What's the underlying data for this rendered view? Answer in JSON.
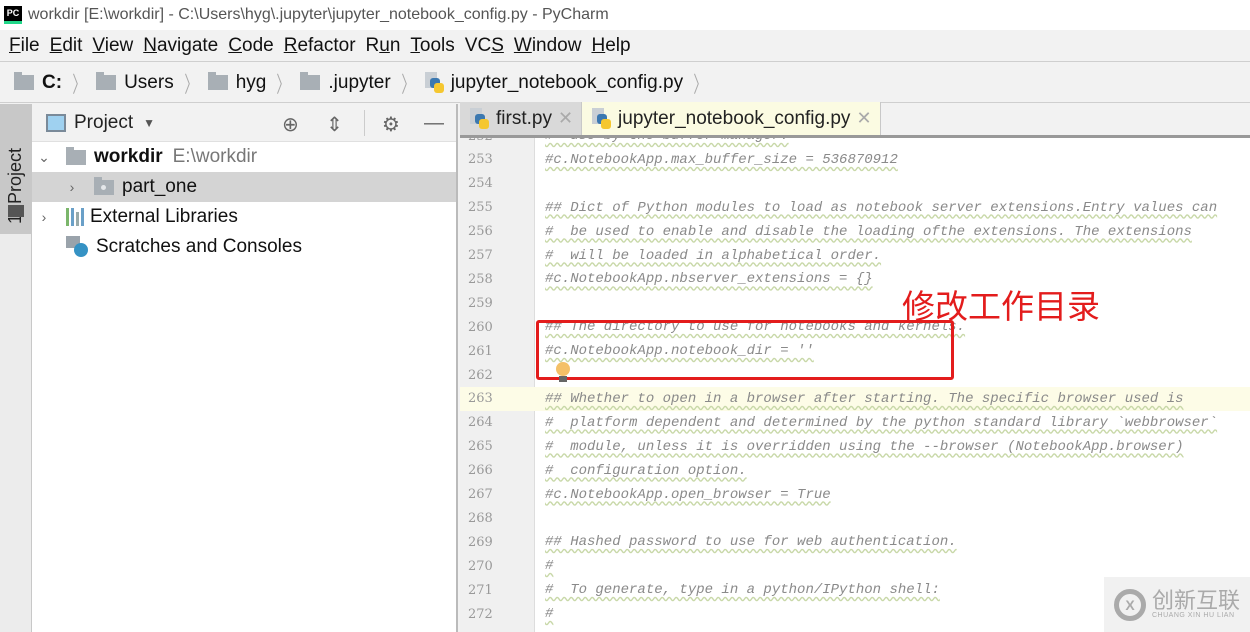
{
  "window": {
    "app_icon": "PC",
    "title": "workdir [E:\\workdir] - C:\\Users\\hyg\\.jupyter\\jupyter_notebook_config.py - PyCharm"
  },
  "menu": [
    {
      "label": "File",
      "mnemonic": "F",
      "rest": "ile"
    },
    {
      "label": "Edit",
      "mnemonic": "E",
      "rest": "dit"
    },
    {
      "label": "View",
      "mnemonic": "V",
      "rest": "iew"
    },
    {
      "label": "Navigate",
      "mnemonic": "N",
      "rest": "avigate"
    },
    {
      "label": "Code",
      "mnemonic": "C",
      "rest": "ode"
    },
    {
      "label": "Refactor",
      "mnemonic": "R",
      "rest": "efactor"
    },
    {
      "label": "Run",
      "pre": "R",
      "mnemonic": "u",
      "rest": "n"
    },
    {
      "label": "Tools",
      "mnemonic": "T",
      "rest": "ools"
    },
    {
      "label": "VCS",
      "pre": "VC",
      "mnemonic": "S",
      "rest": ""
    },
    {
      "label": "Window",
      "mnemonic": "W",
      "rest": "indow"
    },
    {
      "label": "Help",
      "mnemonic": "H",
      "rest": "elp"
    }
  ],
  "breadcrumb": [
    "C:",
    "Users",
    "hyg",
    ".jupyter",
    "jupyter_notebook_config.py"
  ],
  "side_strip": {
    "tab_label": "1: Project"
  },
  "project_panel": {
    "title": "Project",
    "tree": [
      {
        "name": "workdir",
        "path": "E:\\workdir",
        "expanded": true,
        "type": "folder"
      },
      {
        "name": "part_one",
        "expanded": false,
        "type": "package",
        "selected": true
      },
      {
        "name": "External Libraries",
        "expanded": false,
        "type": "libraries"
      },
      {
        "name": "Scratches and Consoles",
        "type": "scratches"
      }
    ]
  },
  "editor": {
    "tabs": [
      {
        "label": "first.py",
        "active": false
      },
      {
        "label": "jupyter_notebook_config.py",
        "active": true
      }
    ],
    "lines": [
      {
        "n": "252",
        "text": "#  use by the buffer manager."
      },
      {
        "n": "253",
        "text": "#c.NotebookApp.max_buffer_size = 536870912"
      },
      {
        "n": "254",
        "text": ""
      },
      {
        "n": "255",
        "text": "## Dict of Python modules to load as notebook server extensions.Entry values can"
      },
      {
        "n": "256",
        "text": "#  be used to enable and disable the loading ofthe extensions. The extensions"
      },
      {
        "n": "257",
        "text": "#  will be loaded in alphabetical order."
      },
      {
        "n": "258",
        "text": "#c.NotebookApp.nbserver_extensions = {}"
      },
      {
        "n": "259",
        "text": ""
      },
      {
        "n": "260",
        "text": "## The directory to use for notebooks and kernels."
      },
      {
        "n": "261",
        "text": "#c.NotebookApp.notebook_dir = ''"
      },
      {
        "n": "262",
        "text": ""
      },
      {
        "n": "263",
        "text": "## Whether to open in a browser after starting. The specific browser used is",
        "current": true
      },
      {
        "n": "264",
        "text": "#  platform dependent and determined by the python standard library `webbrowser`"
      },
      {
        "n": "265",
        "text": "#  module, unless it is overridden using the --browser (NotebookApp.browser)"
      },
      {
        "n": "266",
        "text": "#  configuration option."
      },
      {
        "n": "267",
        "text": "#c.NotebookApp.open_browser = True"
      },
      {
        "n": "268",
        "text": ""
      },
      {
        "n": "269",
        "text": "## Hashed password to use for web authentication."
      },
      {
        "n": "270",
        "text": "#"
      },
      {
        "n": "271",
        "text": "#  To generate, type in a python/IPython shell:"
      },
      {
        "n": "272",
        "text": "#"
      }
    ],
    "annotation": "修改工作目录",
    "annotation_color": "#e31c1c"
  },
  "watermark": {
    "cn": "创新互联",
    "en": "CHUANG XIN HU LIAN"
  }
}
